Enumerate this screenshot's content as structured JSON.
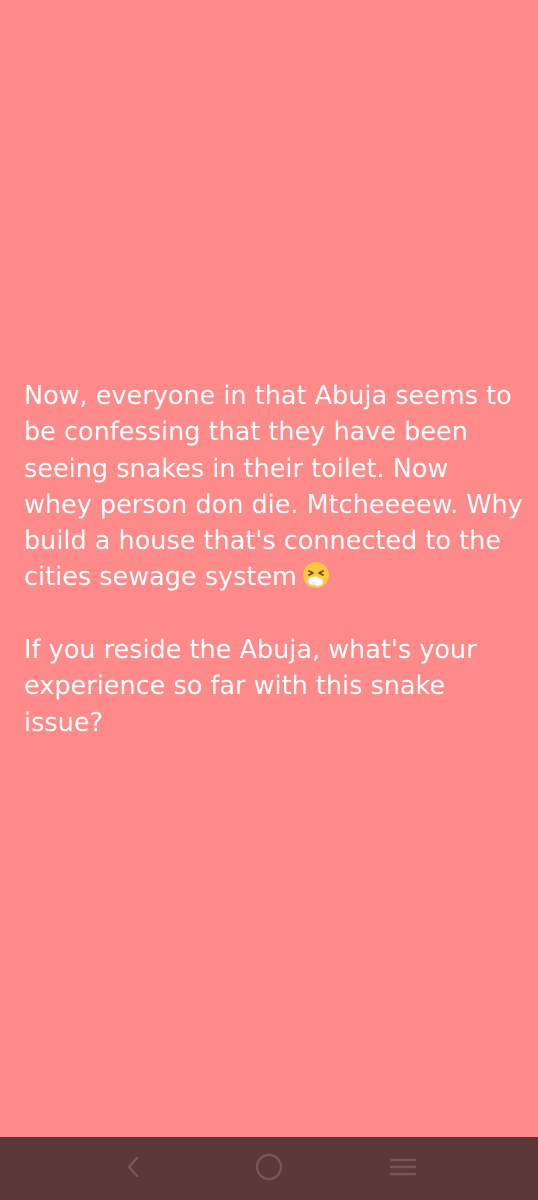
{
  "post": {
    "paragraphs": [
      "Now, everyone in that Abuja seems to be confessing that they have been seeing snakes in their toilet. Now whey person don die. Mtcheeeew. Why build a house that's connected to the cities sewage system",
      "If you reside the Abuja, what's your experience so far with this snake issue?"
    ],
    "emoji": "sneezing-face-emoji"
  },
  "colors": {
    "background": "#FF8A8A",
    "text": "#FFFFFF",
    "navbar": "#5C3838",
    "nav_icons": "#7A5555"
  },
  "navbar": {
    "back_icon": "chevron-left-icon",
    "home_icon": "circle-home-icon",
    "recents_icon": "menu-lines-icon"
  }
}
